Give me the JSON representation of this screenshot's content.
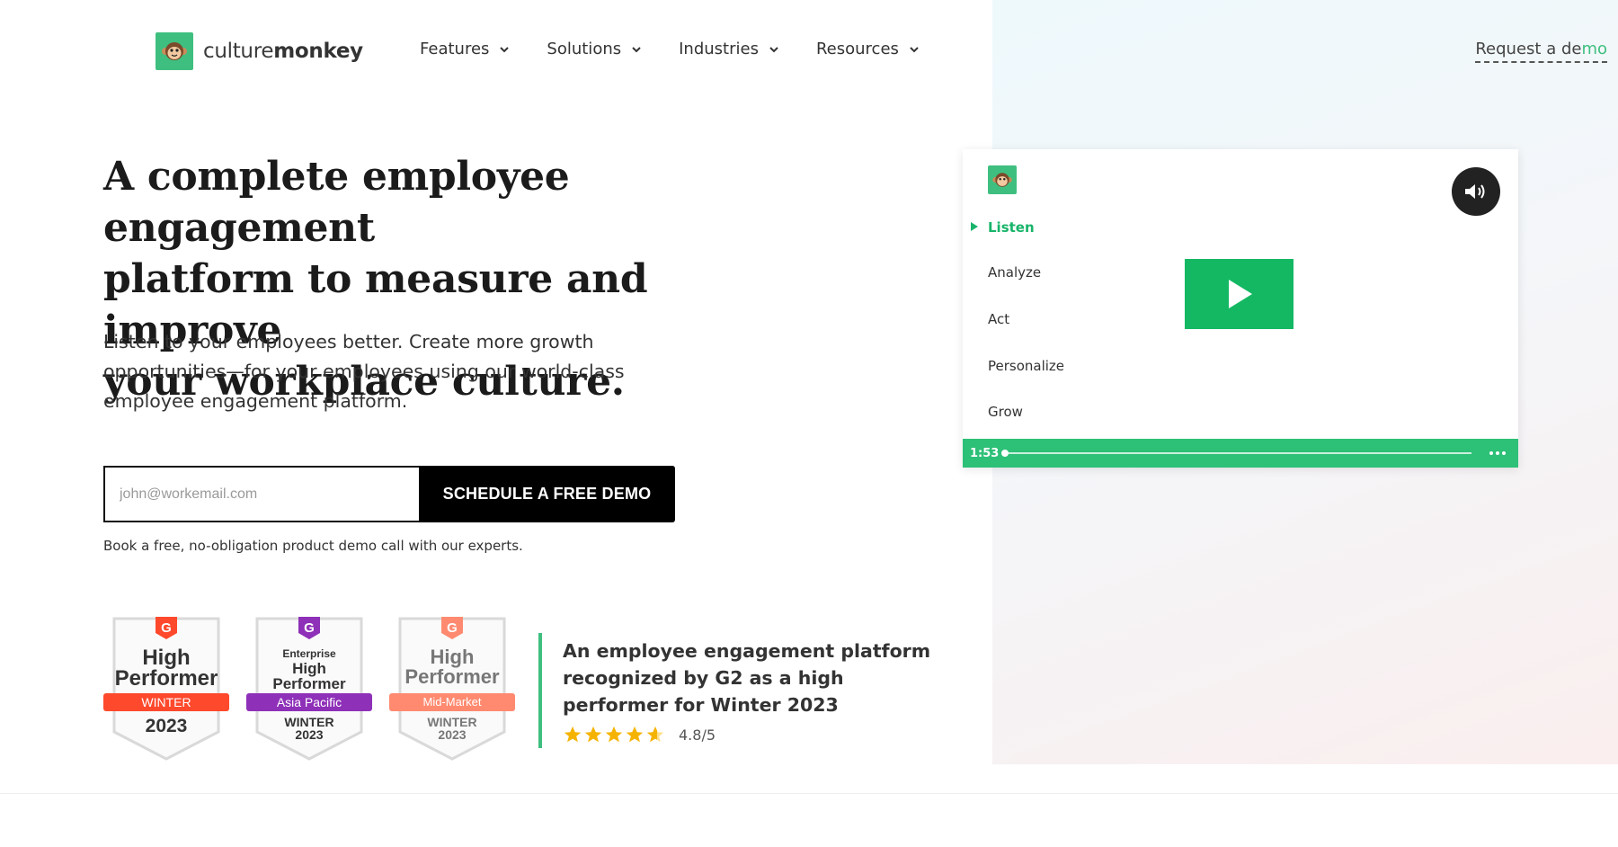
{
  "colors": {
    "brand": "#3fbf7f",
    "play": "#14b863",
    "bar": "#2dc077",
    "star": "#f5b301"
  },
  "header": {
    "logo_light": "culture",
    "logo_bold": "monkey",
    "nav": [
      {
        "label": "Features"
      },
      {
        "label": "Solutions"
      },
      {
        "label": "Industries"
      },
      {
        "label": "Resources"
      }
    ],
    "request_prefix": "Request a ",
    "request_de": "de",
    "request_mo": "mo"
  },
  "hero": {
    "title_line1": "A complete employee engagement",
    "title_line2": "platform to measure and improve",
    "title_line3": "your workplace culture.",
    "subtitle": "Listen to your employees better. Create more growth opportunities—for your employees using our world-class employee engagement platform."
  },
  "form": {
    "email_placeholder": "john@workemail.com",
    "email_value": "",
    "button_label": "SCHEDULE A FREE DEMO",
    "note": "Book a free, no-obligation product demo call with our experts."
  },
  "badges": [
    {
      "brand": "G2",
      "line1": "",
      "line2": "High",
      "line3": "Performer",
      "ribbon": "WINTER",
      "ribbon_color": "#ff492c",
      "year": "2023",
      "tone": "#333"
    },
    {
      "brand": "G2",
      "line1": "Enterprise",
      "line2": "High",
      "line3": "Performer",
      "ribbon": "Asia Pacific",
      "ribbon_color": "#8e30b8",
      "season": "WINTER",
      "year": "2023",
      "tone": "#333"
    },
    {
      "brand": "G2",
      "line1": "",
      "line2": "High",
      "line3": "Performer",
      "ribbon": "Mid-Market",
      "ribbon_color": "#ff8a70",
      "season": "WINTER",
      "year": "2023",
      "tone": "#777"
    }
  ],
  "g2": {
    "text": "An employee engagement platform recognized by G2 as a high performer for Winter 2023",
    "rating_value": 4.8,
    "rating_max": 5,
    "rating_text": "4.8/5",
    "star_icon": "star-icon"
  },
  "video": {
    "menu": [
      {
        "label": "Listen",
        "active": true
      },
      {
        "label": "Analyze",
        "active": false
      },
      {
        "label": "Act",
        "active": false
      },
      {
        "label": "Personalize",
        "active": false
      },
      {
        "label": "Grow",
        "active": false
      }
    ],
    "time": "1:53",
    "progress": 0.0,
    "icons": {
      "sound": "speaker-icon",
      "play": "play-icon",
      "more": "more-icon"
    }
  }
}
